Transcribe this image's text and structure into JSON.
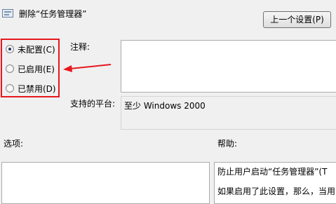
{
  "dialog": {
    "title": "删除“任务管理器”",
    "prev_button": "上一个设置(P)"
  },
  "state_options": [
    {
      "label": "未配置(C)",
      "checked": true
    },
    {
      "label": "已启用(E)",
      "checked": false
    },
    {
      "label": "已禁用(D)",
      "checked": false
    }
  ],
  "fields": {
    "comment_label": "注释:",
    "platform_label": "支持的平台:",
    "platform_value": "至少 Windows 2000",
    "options_label": "选项:",
    "help_label": "帮助:"
  },
  "help_text": {
    "line1": "防止用户启动“任务管理器”(T",
    "line2": "如果启用了此设置，那么，当用"
  },
  "annotation_color": "#e8171d"
}
